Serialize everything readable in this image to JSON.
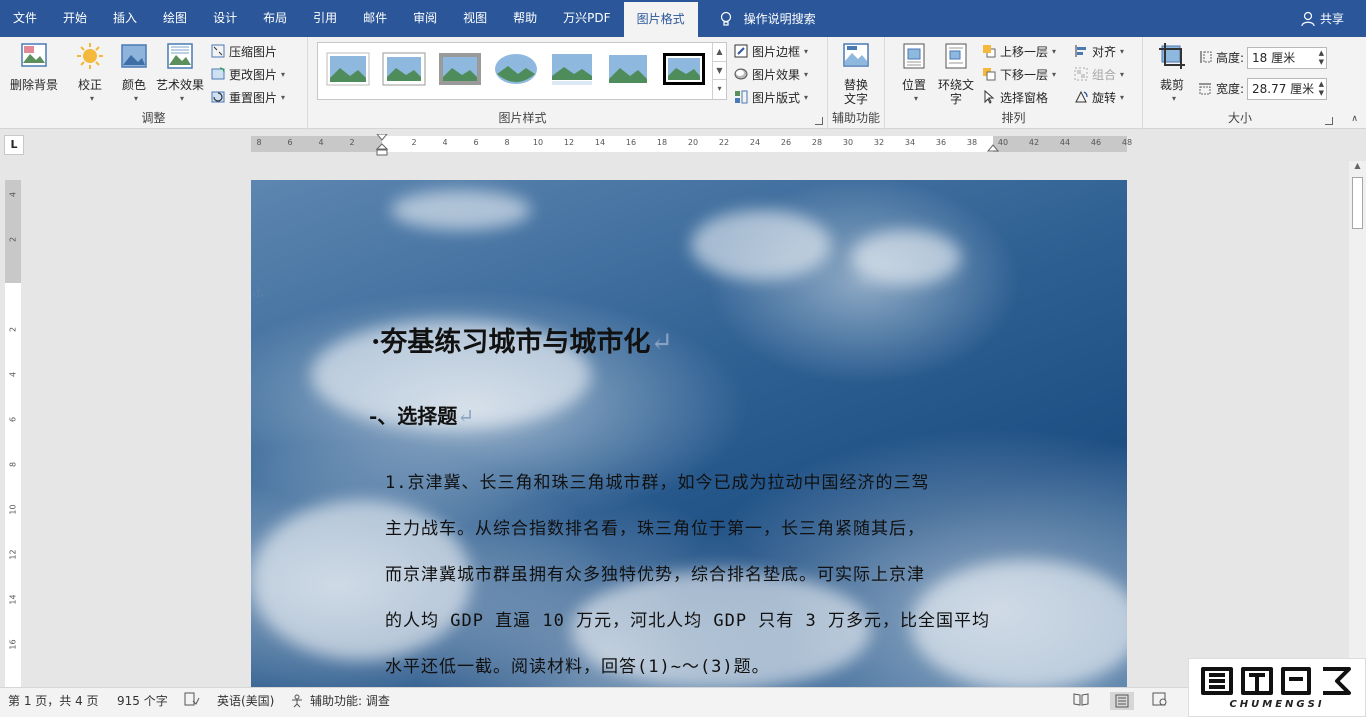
{
  "menubar": {
    "tabs": [
      "文件",
      "开始",
      "插入",
      "绘图",
      "设计",
      "布局",
      "引用",
      "邮件",
      "审阅",
      "视图",
      "帮助",
      "万兴PDF",
      "图片格式"
    ],
    "active_tab": "图片格式",
    "search": "操作说明搜索",
    "share": "共享"
  },
  "ribbon": {
    "adjust": {
      "remove_bg": "删除背景",
      "correct": "校正",
      "color": "颜色",
      "artistic": "艺术效果",
      "compress": "压缩图片",
      "change": "更改图片",
      "reset": "重置图片",
      "label": "调整"
    },
    "styles": {
      "border": "图片边框",
      "effects": "图片效果",
      "layout": "图片版式",
      "label": "图片样式"
    },
    "accessibility": {
      "alt_text_line1": "替换",
      "alt_text_line2": "文字",
      "label": "辅助功能"
    },
    "arrange": {
      "position": "位置",
      "wrap_line1": "环绕文",
      "wrap_line2": "字",
      "bring_forward": "上移一层",
      "send_backward": "下移一层",
      "selection_pane": "选择窗格",
      "align": "对齐",
      "group": "组合",
      "rotate": "旋转",
      "label": "排列"
    },
    "size": {
      "crop": "裁剪",
      "height_label": "高度:",
      "height_value": "18 厘米",
      "width_label": "宽度:",
      "width_value": "28.77 厘米",
      "label": "大小"
    }
  },
  "ruler": {
    "h_ticks": [
      "8",
      "6",
      "4",
      "2",
      "",
      "2",
      "4",
      "6",
      "8",
      "10",
      "12",
      "14",
      "16",
      "18",
      "20",
      "22",
      "24",
      "26",
      "28",
      "30",
      "32",
      "34",
      "36",
      "38",
      "40",
      "42",
      "44",
      "46",
      "48"
    ],
    "v_ticks": [
      "4",
      "2",
      "",
      "2",
      "4",
      "6",
      "8",
      "10",
      "12",
      "14",
      "16"
    ],
    "tab_selector": "L"
  },
  "document": {
    "title": "·夯基练习城市与城市化",
    "section": "-、选择题",
    "lines": [
      "1.京津冀、长三角和珠三角城市群，如今已成为拉动中国经济的三驾",
      "主力战车。从综合指数排名看，珠三角位于第一，长三角紧随其后，",
      "而京津冀城市群虽拥有众多独特优势，综合排名垫底。可实际上京津",
      "的人均 GDP 直逼 10 万元，河北人均 GDP 只有 3 万多元，比全国平均",
      "水平还低一截。阅读材料，回答(1)~～(3)题。"
    ],
    "pilcrow": "↵"
  },
  "status": {
    "page": "第 1 页，共 4 页",
    "words": "915 个字",
    "language": "英语(美国)",
    "accessibility": "辅助功能: 调查"
  },
  "watermark": {
    "text": "CHUMENGSI"
  },
  "colors": {
    "title_bar": "#2b579a",
    "ribbon": "#f3f3f3",
    "canvas": "#e6e6e6"
  }
}
